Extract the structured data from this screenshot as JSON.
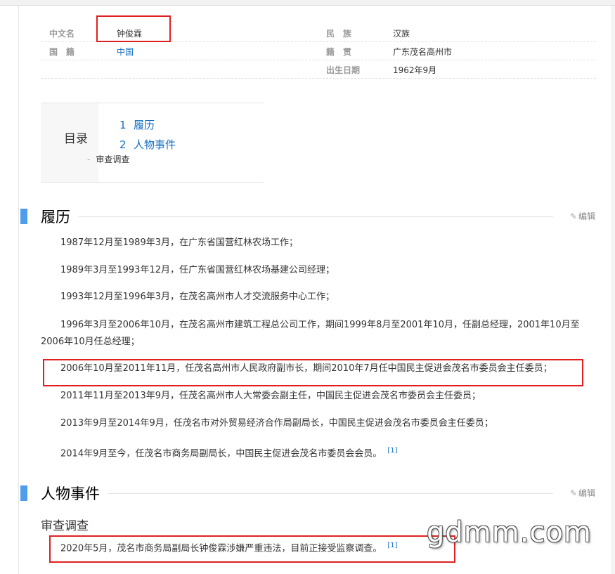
{
  "infobox": {
    "rows": [
      {
        "left_label": "中文名",
        "left_value": "钟俊霖",
        "right_label": "民　族",
        "right_value": "汉族"
      },
      {
        "left_label": "国　籍",
        "left_value": "中国",
        "right_label": "籍　贯",
        "right_value": "广东茂名高州市"
      },
      {
        "left_label": "",
        "left_value": "",
        "right_label": "出生日期",
        "right_value": "1962年9月"
      }
    ]
  },
  "toc": {
    "title": "目录",
    "items": [
      {
        "num": "1",
        "label": "履历"
      },
      {
        "num": "2",
        "label": "人物事件"
      }
    ],
    "sub_dash": "-",
    "sub_item": "审查调查"
  },
  "sections": {
    "resume": {
      "title": "履历",
      "edit": "编辑",
      "paragraphs": [
        "1987年12月至1989年3月，在广东省国营红林农场工作；",
        "1989年3月至1993年12月，任广东省国营红林农场基建公司经理；",
        "1993年12月至1996年3月，在茂名高州市人才交流服务中心工作；",
        "1996年3月至2006年10月，在茂名高州市建筑工程总公司工作，期间1999年8月至2001年10月，任副总经理，2001年10月至2006年10月任总经理；",
        "2006年10月至2011年11月，任茂名高州市人民政府副市长，期间2010年7月任中国民主促进会茂名市委员会主任委员；",
        "2011年11月至2013年9月，任茂名高州市人大常委会副主任，中国民主促进会茂名市委员会主任委员；",
        "2013年9月至2014年9月，任茂名市对外贸易经济合作局副局长，中国民主促进会茂名市委员会主任委员；",
        "2014年9月至今，任茂名市商务局副局长，中国民主促进会茂名市委员会会员。"
      ],
      "ref": "[1]"
    },
    "events": {
      "title": "人物事件",
      "edit": "编辑",
      "subtitle": "审查调查",
      "paragraph": "2020年5月，茂名市商务局副局长钟俊霖涉嫌严重违法，目前正接受监察调查。",
      "ref": "[1]"
    }
  },
  "watermark": "gdmm.com",
  "colors": {
    "accent": "#4f9cee",
    "link": "#136ec2",
    "highlight_box": "#e02020"
  }
}
